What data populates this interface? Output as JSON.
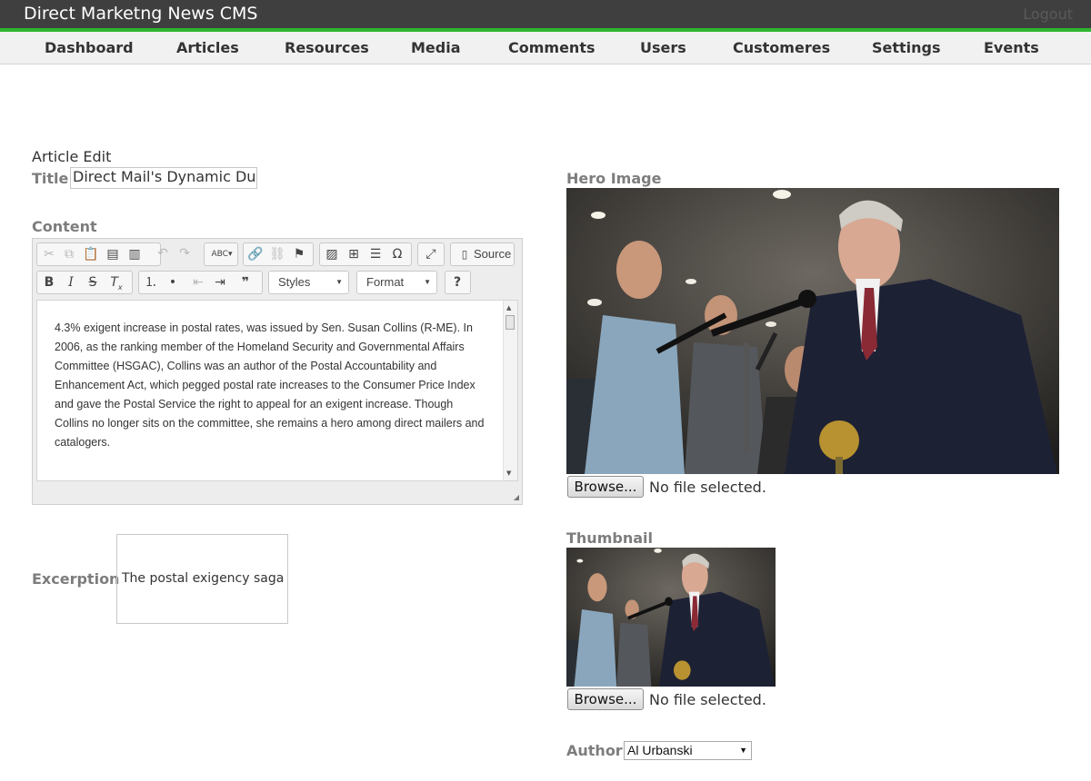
{
  "app": {
    "title": "Direct Marketng News CMS",
    "logout_label": "Logout"
  },
  "nav": {
    "items": [
      "Dashboard",
      "Articles",
      "Resources",
      "Media",
      "Comments",
      "Users",
      "Customeres",
      "Settings",
      "Events"
    ]
  },
  "form": {
    "heading": "Article Edit",
    "title_label": "Title",
    "title_value": "Direct Mail's Dynamic Duo C",
    "content_label": "Content",
    "content_text": "4.3% exigent increase in postal rates, was issued by Sen. Susan Collins (R-ME). In 2006, as the ranking member of the Homeland Security and Governmental Affairs Committee (HSGAC), Collins was an author of the Postal Accountability and Enhancement Act, which pegged postal rate increases to the Consumer Price Index and gave the Postal Service the right to appeal for an exigent increase. Though Collins no longer sits on the committee, she remains a hero among direct mailers and catalogers.",
    "excerption_label": "Excerption",
    "excerption_value": "The postal exigency saga co",
    "hero_label": "Hero Image",
    "thumbnail_label": "Thumbnail",
    "browse_label": "Browse...",
    "no_file_label": "No file selected.",
    "author_label": "Author",
    "author_value": "Al Urbanski"
  },
  "editor_toolbar": {
    "source_label": "Source",
    "styles_label": "Styles",
    "format_label": "Format",
    "help_label": "?"
  },
  "colors": {
    "topbar": "#3f3f3f",
    "accent": "#2fb52f",
    "label": "#7d7d7d"
  }
}
